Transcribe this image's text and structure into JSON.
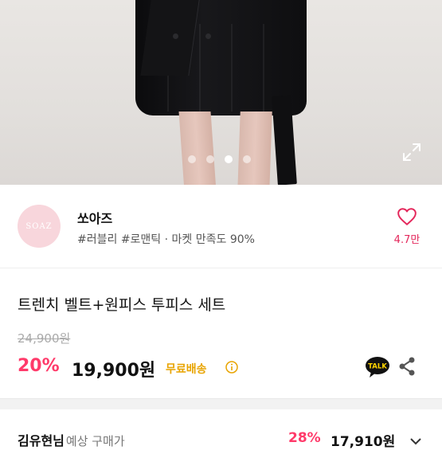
{
  "image_dots": {
    "count": 4,
    "active_index": 2
  },
  "shop": {
    "logo_text": "SOAZ",
    "name": "쏘아즈",
    "tags": "#러블리 #로맨틱 · 마켓 만족도 90%",
    "like_count": "4.7만"
  },
  "product": {
    "title": "트렌치 벨트+원피스 투피스 세트",
    "original_price": "24,900원",
    "discount": "20%",
    "price": "19,900원",
    "shipping": "무료배송",
    "talk_label": "TALK"
  },
  "bottom_bar": {
    "label": "김유현님",
    "sub_label": "예상 구매가",
    "discount": "28%",
    "price": "17,910원"
  },
  "colors": {
    "accent_pink": "#ff3a6a",
    "like_pink": "#e4275b",
    "shipping_gold": "#e8a400",
    "logo_pink": "#f8d6dc"
  },
  "icons": {
    "expand": "expand-icon",
    "heart": "heart-icon",
    "info": "info-icon",
    "talk": "kakao-talk-icon",
    "share": "share-icon",
    "chevron": "chevron-down-icon"
  }
}
